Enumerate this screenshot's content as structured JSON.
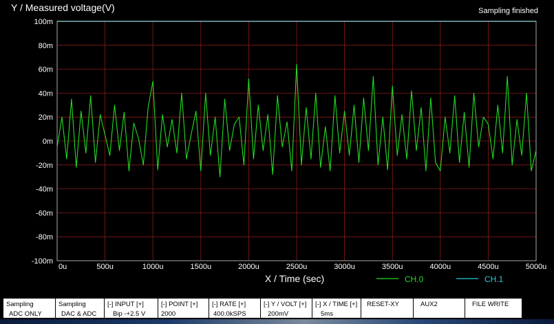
{
  "title": "Y / Measured voltage(V)",
  "status": "Sampling finished",
  "colors": {
    "ch0": "#22dd22",
    "ch1": "#22ccdd",
    "grid": "#8b1a1a",
    "frame": "#aaaaaa"
  },
  "chart_data": {
    "type": "line",
    "xlabel": "X / Time (sec)",
    "ylabel": "Y / Measured voltage(V)",
    "xlim": [
      0,
      5000
    ],
    "ylim": [
      -100,
      100
    ],
    "x_unit": "u",
    "y_unit": "m",
    "xticks": [
      "0u",
      "500u",
      "1000u",
      "1500u",
      "2000u",
      "2500u",
      "3000u",
      "3500u",
      "4000u",
      "4500u",
      "5000u"
    ],
    "yticks": [
      "100m",
      "80m",
      "60m",
      "40m",
      "20m",
      "0m",
      "-20m",
      "-40m",
      "-60m",
      "-80m",
      "-100m"
    ],
    "legend": [
      "CH.0",
      "CH.1"
    ],
    "series": [
      {
        "name": "CH.0",
        "x": [
          0,
          50,
          100,
          150,
          200,
          250,
          300,
          350,
          400,
          450,
          500,
          550,
          600,
          650,
          700,
          750,
          800,
          850,
          900,
          950,
          1000,
          1050,
          1100,
          1150,
          1200,
          1250,
          1300,
          1350,
          1400,
          1450,
          1500,
          1550,
          1600,
          1650,
          1700,
          1750,
          1800,
          1850,
          1900,
          1950,
          2000,
          2050,
          2100,
          2150,
          2200,
          2250,
          2300,
          2350,
          2400,
          2450,
          2500,
          2550,
          2600,
          2650,
          2700,
          2750,
          2800,
          2850,
          2900,
          2950,
          3000,
          3050,
          3100,
          3150,
          3200,
          3250,
          3300,
          3350,
          3400,
          3450,
          3500,
          3550,
          3600,
          3650,
          3700,
          3750,
          3800,
          3850,
          3900,
          3950,
          4000,
          4050,
          4100,
          4150,
          4200,
          4250,
          4300,
          4350,
          4400,
          4450,
          4500,
          4550,
          4600,
          4650,
          4700,
          4750,
          4800,
          4850,
          4900,
          4950,
          5000
        ],
        "y": [
          -5,
          20,
          -15,
          35,
          -22,
          25,
          -10,
          38,
          -18,
          22,
          5,
          -12,
          30,
          -8,
          24,
          -25,
          15,
          2,
          -20,
          28,
          50,
          -24,
          22,
          -5,
          18,
          -10,
          40,
          -15,
          6,
          25,
          -25,
          40,
          -12,
          20,
          -30,
          35,
          -8,
          14,
          20,
          -20,
          52,
          -15,
          30,
          -8,
          22,
          -28,
          38,
          -5,
          16,
          -25,
          64,
          -20,
          28,
          -15,
          40,
          -22,
          12,
          -25,
          38,
          -10,
          25,
          -12,
          30,
          -18,
          36,
          -8,
          54,
          -20,
          20,
          -24,
          46,
          -12,
          22,
          -15,
          42,
          -8,
          28,
          -25,
          36,
          -18,
          -25,
          20,
          -10,
          38,
          -18,
          24,
          -22,
          40,
          -5,
          20,
          14,
          -15,
          30,
          -10,
          54,
          -20,
          18,
          -12,
          40,
          -25,
          -8
        ]
      },
      {
        "name": "CH.1",
        "x": [
          0,
          5000
        ],
        "y": [
          100,
          100
        ]
      }
    ]
  },
  "buttons": [
    {
      "l1": "Sampling",
      "l2": "ADC ONLY"
    },
    {
      "l1": "Sampling",
      "l2": "DAC & ADC"
    },
    {
      "l1": "[-]   INPUT   [+]",
      "l2": "Bip -+2.5 V"
    },
    {
      "l1": "[-]  POINT  [+]",
      "l2": "2000"
    },
    {
      "l1": "[-]    RATE    [+]",
      "l2": "400.0kSPS"
    },
    {
      "l1": "[-]  Y / VOLT [+]",
      "l2": "200mV"
    },
    {
      "l1": "[-]  X / TIME [+]",
      "l2": "5ms"
    },
    {
      "l1": "RESET-XY",
      "l2": ""
    },
    {
      "l1": "AUX2",
      "l2": ""
    },
    {
      "l1": "FILE WRITE",
      "l2": ""
    }
  ]
}
